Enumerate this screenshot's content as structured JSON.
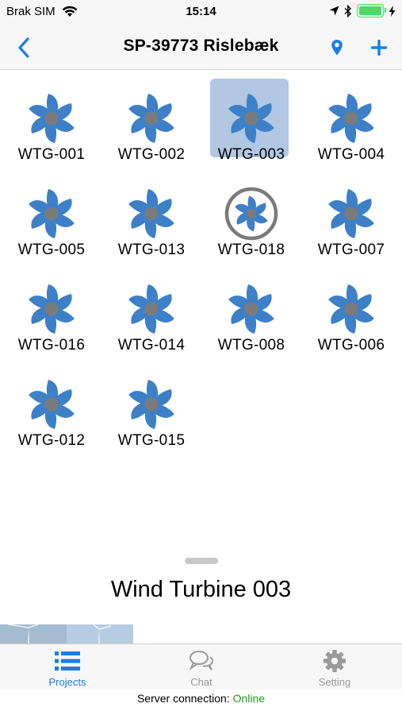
{
  "status_bar": {
    "carrier": "Brak SIM",
    "time": "15:14"
  },
  "nav": {
    "title": "SP-39773 Rislebæk"
  },
  "colors": {
    "accent": "#1a7ee6",
    "turbine_blue": "#3d80c7",
    "hub_gray": "#7a7a7a",
    "selected_bg": "#b1c7e2",
    "online": "#1f9a1f"
  },
  "turbines": [
    {
      "label": "WTG-001",
      "icon": "wind-turbine-icon",
      "selected": false
    },
    {
      "label": "WTG-002",
      "icon": "wind-turbine-icon",
      "selected": false
    },
    {
      "label": "WTG-003",
      "icon": "wind-turbine-icon",
      "selected": true
    },
    {
      "label": "WTG-004",
      "icon": "wind-turbine-icon",
      "selected": false
    },
    {
      "label": "WTG-005",
      "icon": "wind-turbine-icon",
      "selected": false
    },
    {
      "label": "WTG-013",
      "icon": "wind-turbine-icon",
      "selected": false
    },
    {
      "label": "WTG-018",
      "icon": "wind-turbine-ringed-icon",
      "selected": false
    },
    {
      "label": "WTG-007",
      "icon": "wind-turbine-icon",
      "selected": false
    },
    {
      "label": "WTG-016",
      "icon": "wind-turbine-icon",
      "selected": false
    },
    {
      "label": "WTG-014",
      "icon": "wind-turbine-icon",
      "selected": false
    },
    {
      "label": "WTG-008",
      "icon": "wind-turbine-icon",
      "selected": false
    },
    {
      "label": "WTG-006",
      "icon": "wind-turbine-icon",
      "selected": false
    },
    {
      "label": "WTG-012",
      "icon": "wind-turbine-icon",
      "selected": false
    },
    {
      "label": "WTG-015",
      "icon": "wind-turbine-icon",
      "selected": false
    }
  ],
  "sheet": {
    "title": "Wind Turbine 003"
  },
  "tabs": [
    {
      "label": "Projects",
      "icon": "list-icon",
      "active": true
    },
    {
      "label": "Chat",
      "icon": "chat-bubbles-icon",
      "active": false
    },
    {
      "label": "Setting",
      "icon": "gear-icon",
      "active": false
    }
  ],
  "server": {
    "prefix": "Server connection:",
    "state": "Online"
  }
}
